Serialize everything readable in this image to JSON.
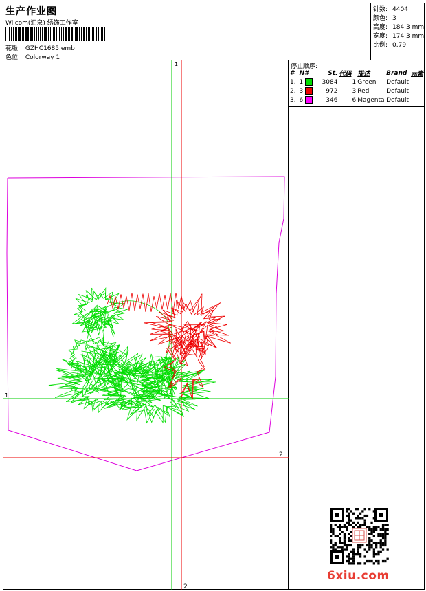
{
  "header": {
    "title": "生产作业图",
    "company": "Wilcom(汇泉) 绣饰工作室",
    "design_label": "花版:",
    "design_value": "GZHC1685.emb",
    "colorway_label": "色位:",
    "colorway_value": "Colorway 1"
  },
  "stats": [
    {
      "label": "针数:",
      "value": "4404"
    },
    {
      "label": "颜色:",
      "value": "3"
    },
    {
      "label": "高度:",
      "value": "184.3 mm"
    },
    {
      "label": "宽度:",
      "value": "174.3 mm"
    },
    {
      "label": "比例:",
      "value": "0.79"
    }
  ],
  "stop_sequence": {
    "title": "停止顺序:",
    "columns": [
      "#",
      "N#",
      "St.",
      "代码",
      "描述",
      "Brand",
      "元素"
    ],
    "rows": [
      {
        "idx": "1.",
        "n": "1",
        "stitches": "3084",
        "code": "1",
        "desc": "Green",
        "brand": "Default",
        "color": "#00dd00"
      },
      {
        "idx": "2.",
        "n": "3",
        "stitches": "972",
        "code": "3",
        "desc": "Red",
        "brand": "Default",
        "color": "#ee0000"
      },
      {
        "idx": "3.",
        "n": "6",
        "stitches": "346",
        "code": "6",
        "desc": "Magenta",
        "brand": "Default",
        "color": "#ff00ff"
      }
    ]
  },
  "guides": {
    "v1_label": "1",
    "v2_label": "2",
    "h1_label": "1",
    "h2_label": "2"
  },
  "watermark": {
    "text": "6xiu.com"
  },
  "colors": {
    "green": "#00dd00",
    "red": "#ee0000",
    "magenta": "#dd00dd"
  },
  "icons": {
    "qr": "qr-code-icon",
    "barcode": "barcode-icon"
  }
}
